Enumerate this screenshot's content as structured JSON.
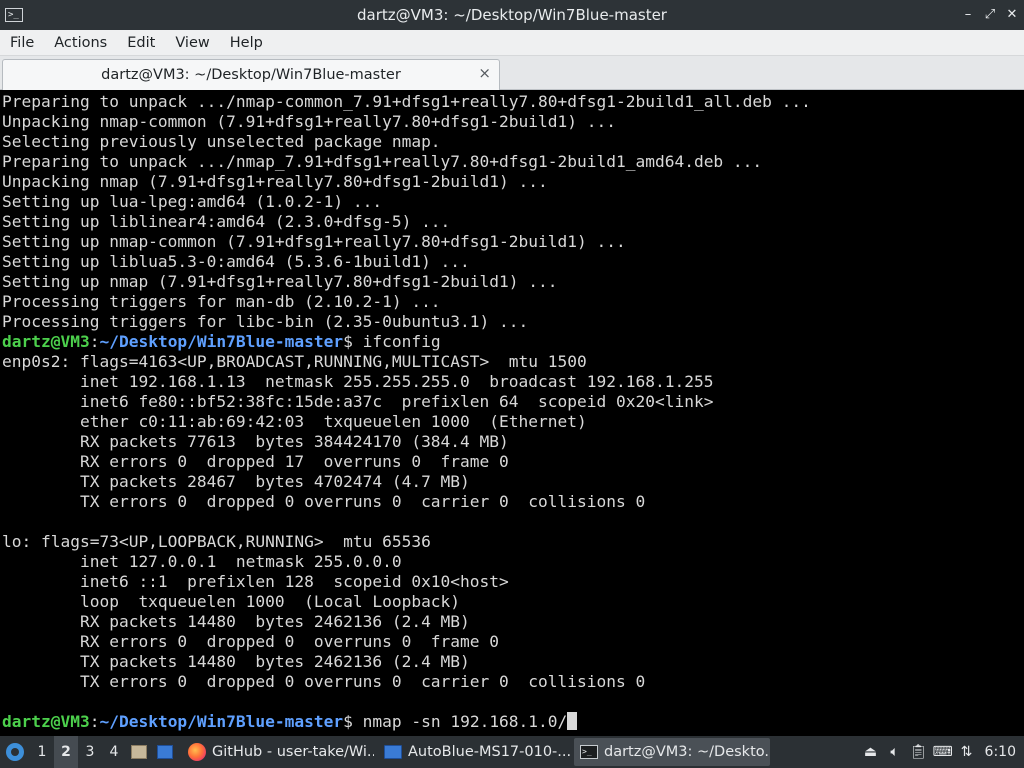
{
  "window": {
    "title": "dartz@VM3: ~/Desktop/Win7Blue-master",
    "icon": "terminal-icon"
  },
  "menu": {
    "items": [
      "File",
      "Actions",
      "Edit",
      "View",
      "Help"
    ]
  },
  "tab": {
    "label": "dartz@VM3: ~/Desktop/Win7Blue-master",
    "close": "×"
  },
  "terminal": {
    "colors": {
      "text": "#d8d8d8",
      "user": "#4cd04c",
      "path": "#5fa0ff",
      "background": "#000000"
    },
    "lines": [
      "Preparing to unpack .../nmap-common_7.91+dfsg1+really7.80+dfsg1-2build1_all.deb ...",
      "Unpacking nmap-common (7.91+dfsg1+really7.80+dfsg1-2build1) ...",
      "Selecting previously unselected package nmap.",
      "Preparing to unpack .../nmap_7.91+dfsg1+really7.80+dfsg1-2build1_amd64.deb ...",
      "Unpacking nmap (7.91+dfsg1+really7.80+dfsg1-2build1) ...",
      "Setting up lua-lpeg:amd64 (1.0.2-1) ...",
      "Setting up liblinear4:amd64 (2.3.0+dfsg-5) ...",
      "Setting up nmap-common (7.91+dfsg1+really7.80+dfsg1-2build1) ...",
      "Setting up liblua5.3-0:amd64 (5.3.6-1build1) ...",
      "Setting up nmap (7.91+dfsg1+really7.80+dfsg1-2build1) ...",
      "Processing triggers for man-db (2.10.2-1) ...",
      "Processing triggers for libc-bin (2.35-0ubuntu3.1) ..."
    ],
    "prompt1": {
      "user": "dartz@VM3",
      "colon": ":",
      "path": "~/Desktop/Win7Blue-master",
      "symbol": "$",
      "command": " ifconfig"
    },
    "output": [
      "enp0s2: flags=4163<UP,BROADCAST,RUNNING,MULTICAST>  mtu 1500",
      "        inet 192.168.1.13  netmask 255.255.255.0  broadcast 192.168.1.255",
      "        inet6 fe80::bf52:38fc:15de:a37c  prefixlen 64  scopeid 0x20<link>",
      "        ether c0:11:ab:69:42:03  txqueuelen 1000  (Ethernet)",
      "        RX packets 77613  bytes 384424170 (384.4 MB)",
      "        RX errors 0  dropped 17  overruns 0  frame 0",
      "        TX packets 28467  bytes 4702474 (4.7 MB)",
      "        TX errors 0  dropped 0 overruns 0  carrier 0  collisions 0",
      "",
      "lo: flags=73<UP,LOOPBACK,RUNNING>  mtu 65536",
      "        inet 127.0.0.1  netmask 255.0.0.0",
      "        inet6 ::1  prefixlen 128  scopeid 0x10<host>",
      "        loop  txqueuelen 1000  (Local Loopback)",
      "        RX packets 14480  bytes 2462136 (2.4 MB)",
      "        RX errors 0  dropped 0  overruns 0  frame 0",
      "        TX packets 14480  bytes 2462136 (2.4 MB)",
      "        TX errors 0  dropped 0 overruns 0  carrier 0  collisions 0",
      ""
    ],
    "prompt2": {
      "user": "dartz@VM3",
      "colon": ":",
      "path": "~/Desktop/Win7Blue-master",
      "symbol": "$",
      "command": " nmap -sn 192.168.1.0/"
    }
  },
  "taskbar": {
    "workspaces": [
      "1",
      "2",
      "3",
      "4"
    ],
    "active_workspace": "2",
    "tasks": [
      {
        "label": "GitHub - user-take/Wi...",
        "icon": "firefox-icon"
      },
      {
        "label": "AutoBlue-MS17-010-...",
        "icon": "folder-icon"
      },
      {
        "label": "dartz@VM3: ~/Deskto...",
        "icon": "terminal-icon"
      }
    ],
    "tray_icons": [
      "eject-icon",
      "volume-icon",
      "clipboard-icon",
      "keyboard-icon",
      "network-icon"
    ],
    "clock": "6:10"
  }
}
